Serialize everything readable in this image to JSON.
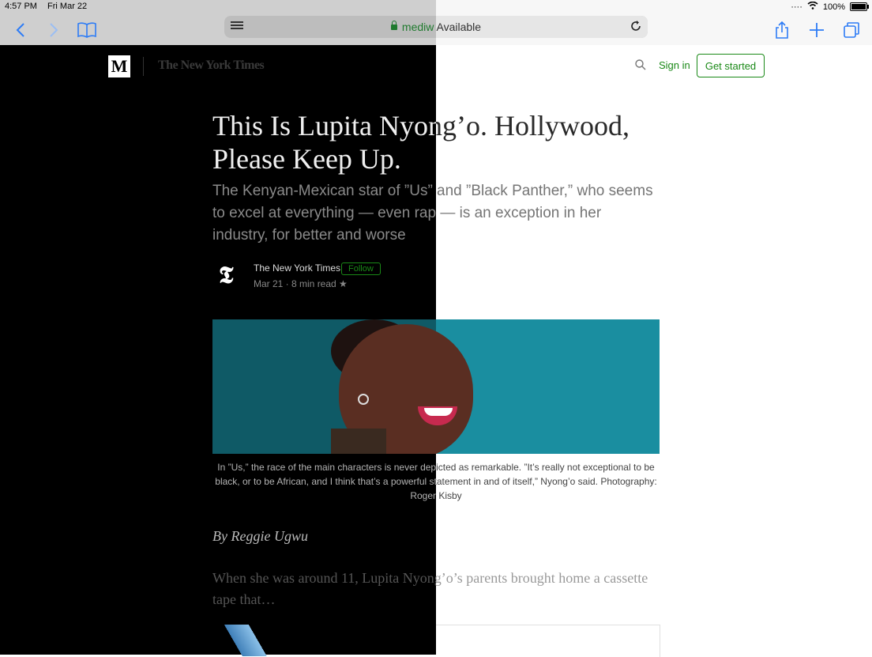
{
  "status": {
    "time": "4:57 PM",
    "date": "Fri Mar 22",
    "battery": "100%",
    "battery_level": 1.0
  },
  "toolbar": {
    "address_domain": "mediw",
    "address_suffix": " Available",
    "icons": [
      "back-icon",
      "forward-icon",
      "bookmarks-icon",
      "reader-icon",
      "reload-icon",
      "share-icon",
      "new-tab-icon",
      "tabs-icon"
    ]
  },
  "header": {
    "logo": "M",
    "publication": "The New York Times",
    "sign_in": "Sign in",
    "get_started": "Get started"
  },
  "article": {
    "title": "This Is Lupita Nyong’o. Hollywood, Please Keep Up.",
    "subtitle": "The Kenyan-Mexican star of ”Us” and ”Black Panther,” who seems to excel at everything — even rap — is an exception in her industry, for better and worse",
    "author_name": "The New York Times",
    "follow": "Follow",
    "meta": "Mar 21 · 8 min read ★",
    "caption": "In ”Us,” the race of the main characters is never depicted as remarkable. ”It’s really not exceptional to be black, or to be African, and I think that’s a powerful statement in and of itself,” Nyong’o said. Photography: Roger Kisby",
    "byline": "By Reggie Ugwu",
    "body": "When she was around 11, Lupita Nyong’o’s parents brought home a cassette tape that…"
  },
  "colors": {
    "accent": "#1a8917",
    "safari_blue": "#2d7cf6"
  }
}
